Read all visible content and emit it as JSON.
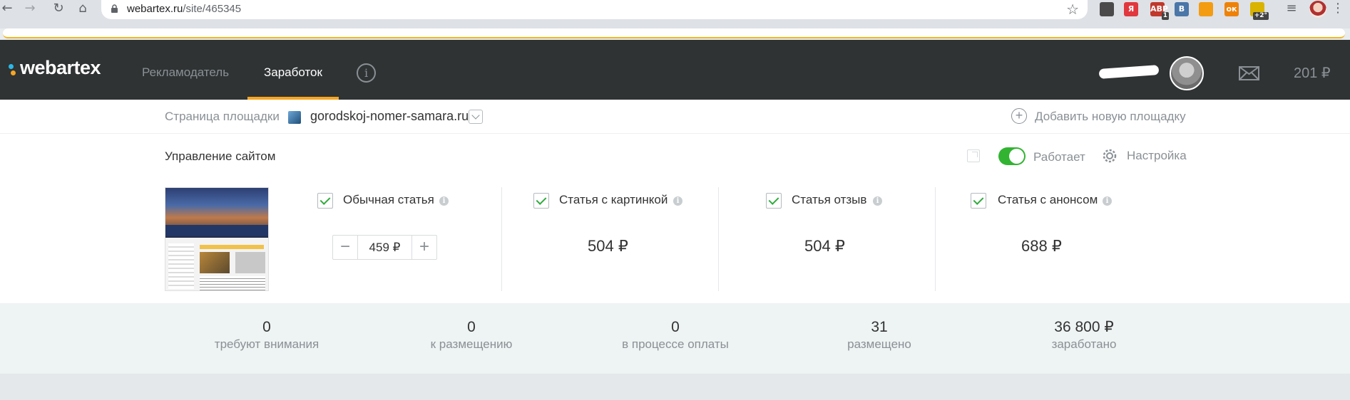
{
  "browser": {
    "url_host": "webartex.ru",
    "url_path": "/site/465345",
    "extensions": [
      {
        "icon": "ext-tool-icon",
        "label": "",
        "color": "#4a4a4a",
        "badge": ""
      },
      {
        "icon": "ext-yandex-icon",
        "label": "Я",
        "color": "#e0383e",
        "badge": ""
      },
      {
        "icon": "ext-abp-icon",
        "label": "ABP",
        "color": "#c0392b",
        "badge": "1"
      },
      {
        "icon": "ext-vk-icon",
        "label": "B",
        "color": "#4a76a8",
        "badge": ""
      },
      {
        "icon": "ext-rss-icon",
        "label": "",
        "color": "#f39c12",
        "badge": ""
      },
      {
        "icon": "ext-ok-icon",
        "label": "ок",
        "color": "#ee8208",
        "badge": ""
      },
      {
        "icon": "ext-weather-icon",
        "label": "",
        "color": "#d9b300",
        "badge": "+2°"
      }
    ]
  },
  "header": {
    "logo": "webartex",
    "nav": [
      {
        "label": "Рекламодатель",
        "active": false
      },
      {
        "label": "Заработок",
        "active": true
      }
    ],
    "balance": "201 ₽"
  },
  "site": {
    "label": "Страница площадки",
    "domain": "gorodskoj-nomer-samara.ru",
    "add_label": "Добавить новую площадку"
  },
  "management": {
    "title": "Управление сайтом",
    "status": "Работает",
    "settings": "Настройка",
    "articles": [
      {
        "label": "Обычная статья",
        "checked": true,
        "price": "459 ₽",
        "editable": true
      },
      {
        "label": "Статья с картинкой",
        "checked": true,
        "price": "504 ₽",
        "editable": false
      },
      {
        "label": "Статья отзыв",
        "checked": true,
        "price": "504 ₽",
        "editable": false
      },
      {
        "label": "Статья с анонсом",
        "checked": true,
        "price": "688 ₽",
        "editable": false
      }
    ]
  },
  "stats": [
    {
      "value": "0",
      "caption": "требуют внимания"
    },
    {
      "value": "0",
      "caption": "к размещению"
    },
    {
      "value": "0",
      "caption": "в процессе оплаты"
    },
    {
      "value": "31",
      "caption": "размещено"
    },
    {
      "value": "36 800 ₽",
      "caption": "заработано"
    }
  ]
}
